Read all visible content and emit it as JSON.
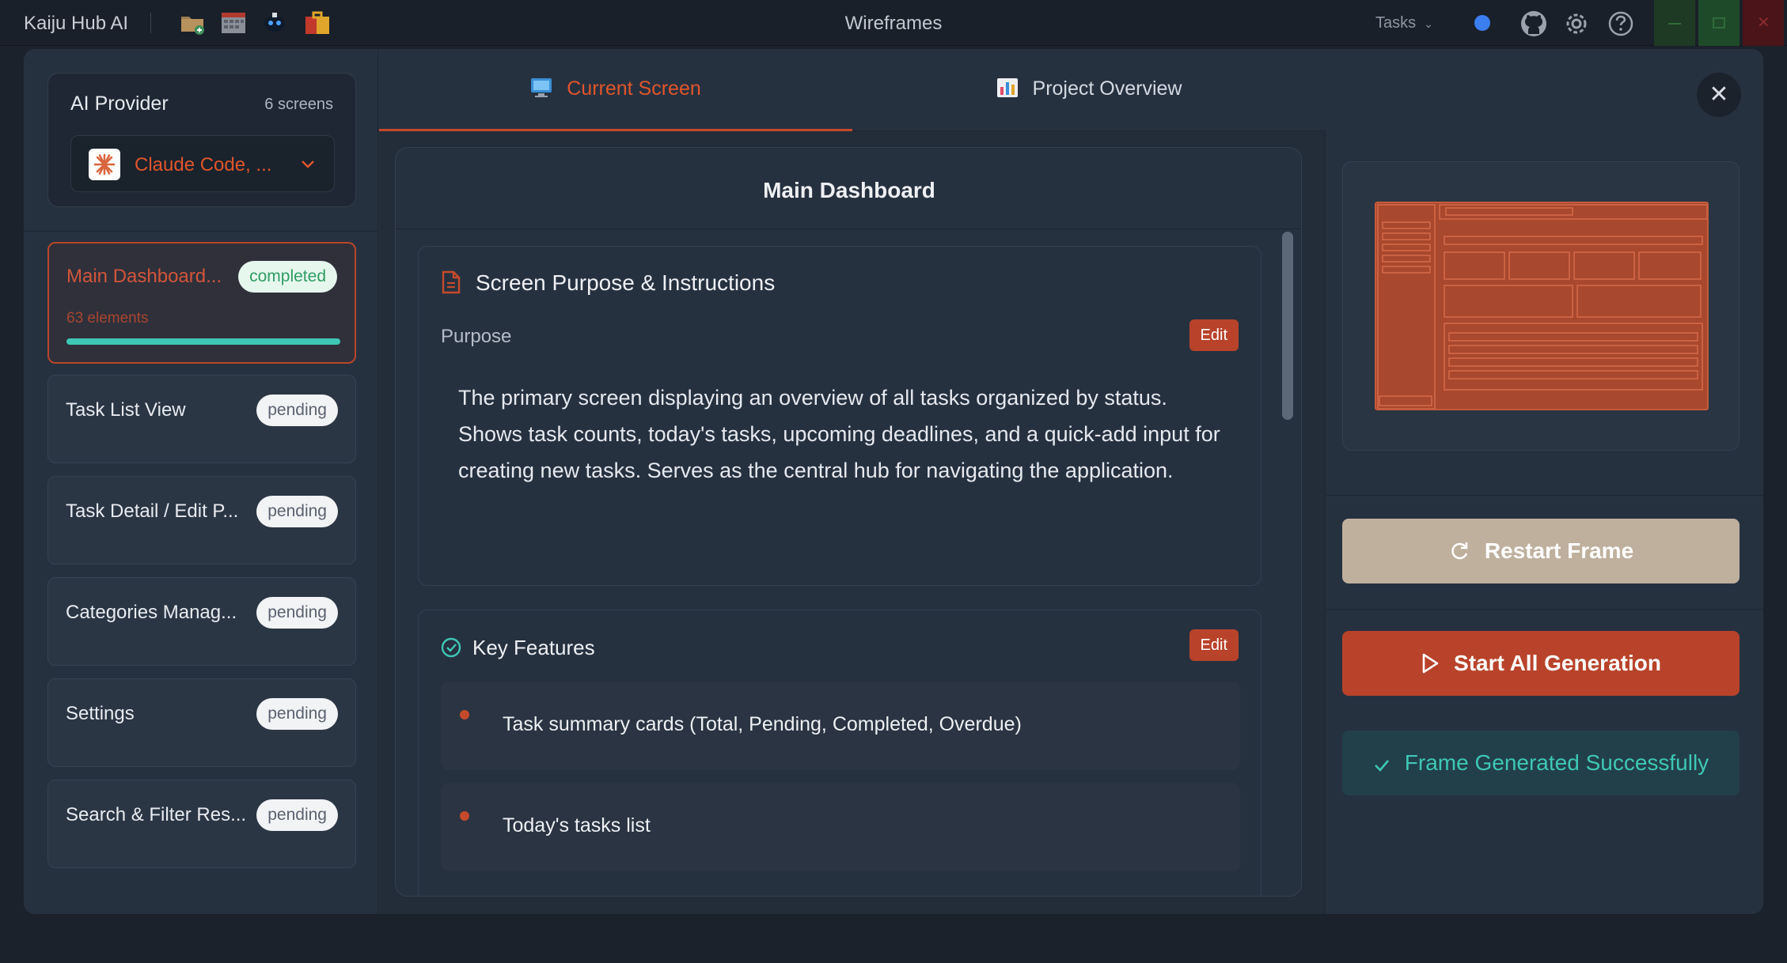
{
  "titlebar": {
    "app_name": "Kaiju Hub AI",
    "window_title": "Wireframes",
    "tasks_label": "Tasks",
    "icons": [
      "folder-add-icon",
      "calendar-grid-icon",
      "robot-icon",
      "suitcase-icon",
      "github-icon",
      "gear-icon",
      "help-icon"
    ]
  },
  "provider": {
    "title": "AI Provider",
    "screen_count": "6 screens",
    "selected": "Claude Code, ..."
  },
  "screens": [
    {
      "name": "Main Dashboard...",
      "status": "completed",
      "elements": "63 elements",
      "progress": 1.0
    },
    {
      "name": "Task List View",
      "status": "pending"
    },
    {
      "name": "Task Detail / Edit P...",
      "status": "pending"
    },
    {
      "name": "Categories Manag...",
      "status": "pending"
    },
    {
      "name": "Settings",
      "status": "pending"
    },
    {
      "name": "Search & Filter Res...",
      "status": "pending"
    }
  ],
  "tabs": {
    "current": "Current Screen",
    "overview": "Project Overview"
  },
  "screen_detail": {
    "title": "Main Dashboard",
    "purpose_section": {
      "heading": "Screen Purpose & Instructions",
      "label": "Purpose",
      "edit": "Edit",
      "text": "The primary screen displaying an overview of all tasks organized by status. Shows task counts, today's tasks, upcoming deadlines, and a quick-add input for creating new tasks. Serves as the central hub for navigating the application."
    },
    "features_section": {
      "heading": "Key Features",
      "edit": "Edit",
      "items": [
        "Task summary cards (Total, Pending, Completed, Overdue)",
        "Today's tasks list"
      ]
    }
  },
  "actions": {
    "restart": "Restart Frame",
    "start_all": "Start All Generation",
    "success": "Frame Generated Successfully"
  },
  "colors": {
    "accent": "#b8432a",
    "accent_text": "#e0552b",
    "success": "#3ec7b5",
    "panel": "#263140",
    "background": "#1b222c"
  }
}
